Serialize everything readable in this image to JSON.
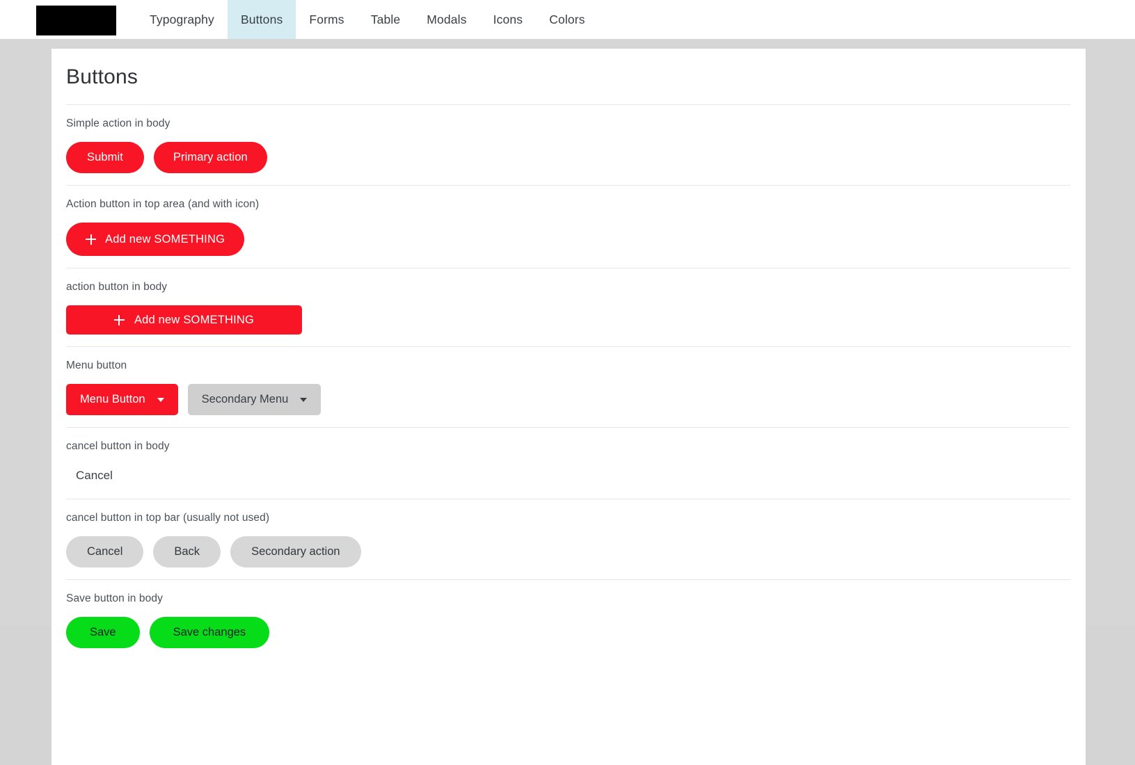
{
  "nav": {
    "logo_alt": "logo-placeholder",
    "items": [
      {
        "label": "Typography",
        "active": false
      },
      {
        "label": "Buttons",
        "active": true
      },
      {
        "label": "Forms",
        "active": false
      },
      {
        "label": "Table",
        "active": false
      },
      {
        "label": "Modals",
        "active": false
      },
      {
        "label": "Icons",
        "active": false
      },
      {
        "label": "Colors",
        "active": false
      }
    ]
  },
  "page": {
    "title": "Buttons"
  },
  "sections": {
    "simple": {
      "label": "Simple action in body",
      "submit": "Submit",
      "primary": "Primary action"
    },
    "top_area": {
      "label": "Action button in top area (and with icon)",
      "add": "Add new SOMETHING"
    },
    "body_action": {
      "label": "action button in body",
      "add": "Add new SOMETHING"
    },
    "menu": {
      "label": "Menu button",
      "primary_menu": "Menu Button",
      "secondary_menu": "Secondary Menu"
    },
    "cancel_body": {
      "label": "cancel button in body",
      "cancel": "Cancel"
    },
    "cancel_topbar": {
      "label": "cancel button in top bar (usually not used)",
      "cancel": "Cancel",
      "back": "Back",
      "secondary": "Secondary action"
    },
    "save": {
      "label": "Save button in body",
      "save": "Save",
      "save_changes": "Save changes"
    }
  },
  "colors": {
    "red": "#f81526",
    "green": "#07dc18",
    "gray_button": "#d7d7d7",
    "active_tab": "#d4ecf2",
    "page_background": "#d6d6d6"
  }
}
